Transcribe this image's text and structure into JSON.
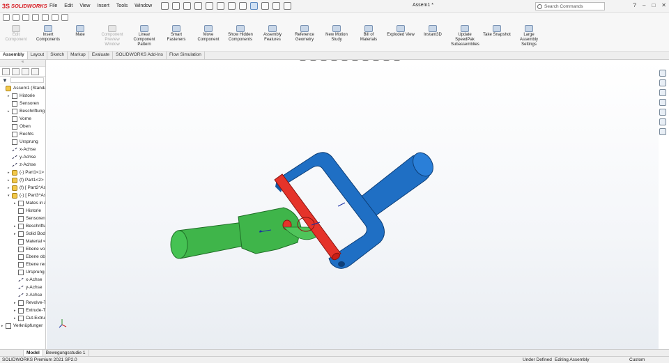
{
  "app": {
    "brand": "SOLIDWORKS",
    "document_title": "Assem1 *"
  },
  "menu": [
    "File",
    "Edit",
    "View",
    "Insert",
    "Tools",
    "Window"
  ],
  "search": {
    "placeholder": "Search Commands"
  },
  "commands": [
    {
      "label": "Edit Component",
      "disabled": true
    },
    {
      "label": "Insert Components",
      "disabled": false
    },
    {
      "label": "Mate",
      "disabled": false
    },
    {
      "label": "Component Preview Window",
      "disabled": true
    },
    {
      "label": "Linear Component Pattern",
      "disabled": false
    },
    {
      "label": "Smart Fasteners",
      "disabled": false
    },
    {
      "label": "Move Component",
      "disabled": false
    },
    {
      "label": "Show Hidden Components",
      "disabled": false
    },
    {
      "label": "Assembly Features",
      "disabled": false
    },
    {
      "label": "Reference Geometry",
      "disabled": false
    },
    {
      "label": "New Motion Study",
      "disabled": false
    },
    {
      "label": "Bill of Materials",
      "disabled": false
    },
    {
      "label": "Exploded View",
      "disabled": false
    },
    {
      "label": "Instant3D",
      "disabled": false
    },
    {
      "label": "Update SpeedPak Subassemblies",
      "disabled": false
    },
    {
      "label": "Take Snapshot",
      "disabled": false
    },
    {
      "label": "Large Assembly Settings",
      "disabled": false
    }
  ],
  "tabs": [
    "Assembly",
    "Layout",
    "Sketch",
    "Markup",
    "Evaluate",
    "SOLIDWORKS Add-Ins",
    "Flow Simulation"
  ],
  "tree": [
    {
      "label": "Assem1  (Standard-",
      "level": 0,
      "icon": "assembly",
      "expander": ""
    },
    {
      "label": "Historie",
      "level": 1,
      "icon": "history",
      "expander": "▸"
    },
    {
      "label": "Sensoren",
      "level": 1,
      "icon": "sensor",
      "expander": ""
    },
    {
      "label": "Beschriftung",
      "level": 1,
      "icon": "annotation",
      "expander": "▸"
    },
    {
      "label": "Vorne",
      "level": 1,
      "icon": "plane",
      "expander": ""
    },
    {
      "label": "Oben",
      "level": 1,
      "icon": "plane",
      "expander": ""
    },
    {
      "label": "Rechts",
      "level": 1,
      "icon": "plane",
      "expander": ""
    },
    {
      "label": "Ursprung",
      "level": 1,
      "icon": "origin",
      "expander": ""
    },
    {
      "label": "x-Achse",
      "level": 1,
      "icon": "axis",
      "expander": ""
    },
    {
      "label": "y-Achse",
      "level": 1,
      "icon": "axis",
      "expander": ""
    },
    {
      "label": "z-Achse",
      "level": 1,
      "icon": "axis",
      "expander": ""
    },
    {
      "label": "(-) Part1<1> (S",
      "level": 1,
      "icon": "part",
      "expander": "▸"
    },
    {
      "label": "(f) Part1<2> (S",
      "level": 1,
      "icon": "part",
      "expander": "▸"
    },
    {
      "label": "(f) [ Part2^Asse",
      "level": 1,
      "icon": "part",
      "expander": "▸"
    },
    {
      "label": "(-) [ Part3^Asse",
      "level": 1,
      "icon": "part",
      "expander": "▾"
    },
    {
      "label": "Mates in A",
      "level": 2,
      "icon": "mates",
      "expander": "▸"
    },
    {
      "label": "Historie",
      "level": 2,
      "icon": "history",
      "expander": ""
    },
    {
      "label": "Sensoren",
      "level": 2,
      "icon": "sensor",
      "expander": ""
    },
    {
      "label": "Beschriftu",
      "level": 2,
      "icon": "annotation",
      "expander": "▸"
    },
    {
      "label": "Solid Bodie",
      "level": 2,
      "icon": "bodies",
      "expander": "▸"
    },
    {
      "label": "Material <r",
      "level": 2,
      "icon": "material",
      "expander": ""
    },
    {
      "label": "Ebene vorn",
      "level": 2,
      "icon": "plane",
      "expander": ""
    },
    {
      "label": "Ebene obe",
      "level": 2,
      "icon": "plane",
      "expander": ""
    },
    {
      "label": "Ebene rech",
      "level": 2,
      "icon": "plane",
      "expander": ""
    },
    {
      "label": "Ursprung",
      "level": 2,
      "icon": "origin",
      "expander": ""
    },
    {
      "label": "x-Achse",
      "level": 2,
      "icon": "axis",
      "expander": ""
    },
    {
      "label": "y-Achse",
      "level": 2,
      "icon": "axis",
      "expander": ""
    },
    {
      "label": "z-Achse",
      "level": 2,
      "icon": "axis",
      "expander": ""
    },
    {
      "label": "Revolve-Th",
      "level": 2,
      "icon": "feature",
      "expander": "▸"
    },
    {
      "label": "Extrude-Th",
      "level": 2,
      "icon": "feature",
      "expander": "▸"
    },
    {
      "label": "Cut-Extruc",
      "level": 2,
      "icon": "feature",
      "expander": "▸"
    },
    {
      "label": "Verknüpfunger",
      "level": 0,
      "icon": "mates",
      "expander": "▸"
    }
  ],
  "bottom_tabs": [
    "Model",
    "Bewegungsstudie 1"
  ],
  "status": {
    "version": "SOLIDWORKS Premium 2021 SP2.0",
    "state": "Under Defined",
    "mode": "Editing Assembly",
    "units": "Custom"
  },
  "colors": {
    "part_green": "#3fb54a",
    "part_blue": "#1f6fc4",
    "part_red": "#e5332a"
  }
}
